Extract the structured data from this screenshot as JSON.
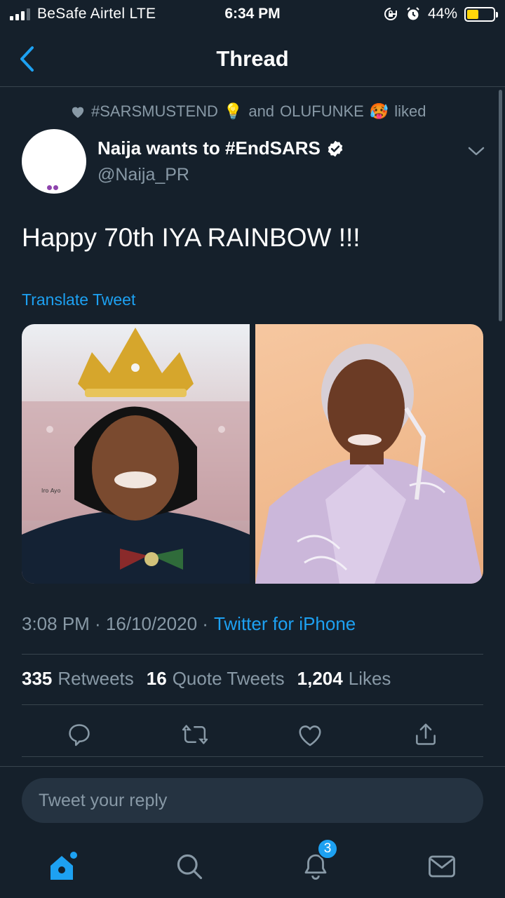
{
  "status_bar": {
    "carrier": "BeSafe Airtel  LTE",
    "time": "6:34 PM",
    "battery": "44%",
    "battery_level": 0.44,
    "icons": [
      "signal-icon",
      "rotation-lock-icon",
      "alarm-icon",
      "battery-charging-icon"
    ]
  },
  "nav": {
    "title": "Thread",
    "back_icon": "chevron-left-icon"
  },
  "tweet": {
    "social_context": {
      "name1": "#SARSMUSTEND",
      "name1_emoji": "💡",
      "connector": "and",
      "name2": "OLUFUNKE",
      "name2_emoji": "🥵",
      "suffix": "liked"
    },
    "author": {
      "name": "Naija wants to #EndSARS",
      "handle": "@Naija_PR",
      "verified": true
    },
    "text": "Happy 70th IYA RAINBOW !!!",
    "translate_label": "Translate Tweet",
    "media": [
      "photo-crowned-woman",
      "photo-woman-lilac-suit"
    ],
    "timestamp": "3:08 PM · 16/10/2020 ·",
    "source": "Twitter for iPhone",
    "stats": {
      "retweets": {
        "count": "335",
        "label": "Retweets"
      },
      "quotes": {
        "count": "16",
        "label": "Quote Tweets"
      },
      "likes": {
        "count": "1,204",
        "label": "Likes"
      }
    }
  },
  "reply": {
    "placeholder": "Tweet your reply"
  },
  "tab_bar": {
    "notifications_badge": "3",
    "tabs": [
      "home-icon",
      "search-icon",
      "bell-icon",
      "mail-icon"
    ]
  },
  "colors": {
    "background": "#15202b",
    "accent": "#1da1f2",
    "secondary_text": "#8899a6",
    "divider": "#38444d",
    "battery": "#ffd60a"
  }
}
